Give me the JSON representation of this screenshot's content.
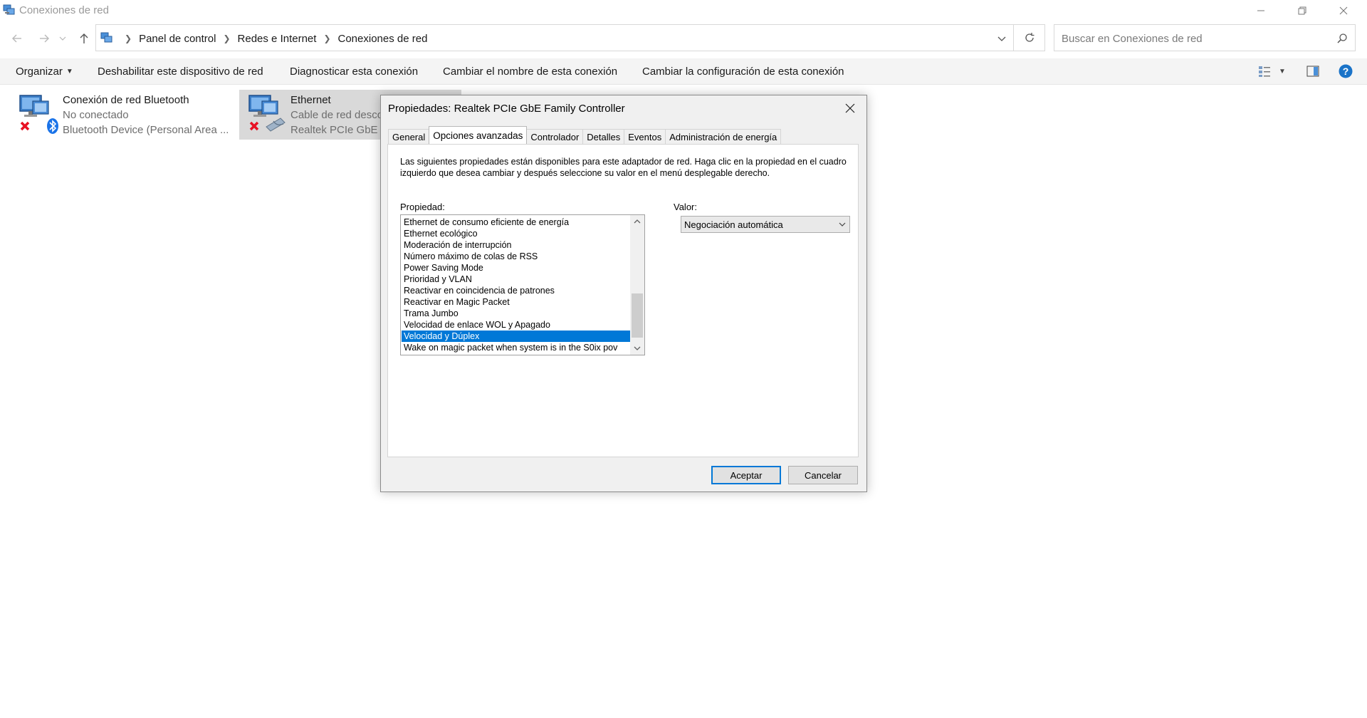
{
  "window": {
    "title": "Conexiones de red"
  },
  "address": {
    "crumbs": [
      "Panel de control",
      "Redes e Internet",
      "Conexiones de red"
    ],
    "search_placeholder": "Buscar en Conexiones de red"
  },
  "toolbar": {
    "organize": "Organizar",
    "disable": "Deshabilitar este dispositivo de red",
    "diagnose": "Diagnosticar esta conexión",
    "rename": "Cambiar el nombre de esta conexión",
    "change_config": "Cambiar la configuración de esta conexión"
  },
  "connections": [
    {
      "name": "Conexión de red Bluetooth",
      "status": "No conectado",
      "device": "Bluetooth Device (Personal Area ..."
    },
    {
      "name": "Ethernet",
      "status": "Cable de red desco",
      "device": "Realtek PCIe GbE Fa"
    }
  ],
  "dialog": {
    "title": "Propiedades: Realtek PCIe GbE Family Controller",
    "tabs": [
      "General",
      "Opciones avanzadas",
      "Controlador",
      "Detalles",
      "Eventos",
      "Administración de energía"
    ],
    "active_tab": "Opciones avanzadas",
    "description": "Las siguientes propiedades están disponibles para este adaptador de red. Haga clic en la propiedad en el cuadro izquierdo que desea cambiar y después seleccione su valor en el menú desplegable derecho.",
    "property_label": "Propiedad:",
    "value_label": "Valor:",
    "properties": [
      "Ethernet de consumo eficiente de energía",
      "Ethernet ecológico",
      "Moderación de interrupción",
      "Número máximo de colas de RSS",
      "Power Saving Mode",
      "Prioridad y VLAN",
      "Reactivar en coincidencia de patrones",
      "Reactivar en Magic Packet",
      "Trama Jumbo",
      "Velocidad de enlace WOL y Apagado",
      "Velocidad y Dúplex",
      "Wake on magic packet when system is in the S0ix pov"
    ],
    "selected_property": "Velocidad y Dúplex",
    "value": "Negociación automática",
    "ok_label": "Aceptar",
    "cancel_label": "Cancelar"
  },
  "colors": {
    "accent": "#0078d7",
    "selection_bg": "#d9d9d9",
    "error_red": "#e81123"
  }
}
